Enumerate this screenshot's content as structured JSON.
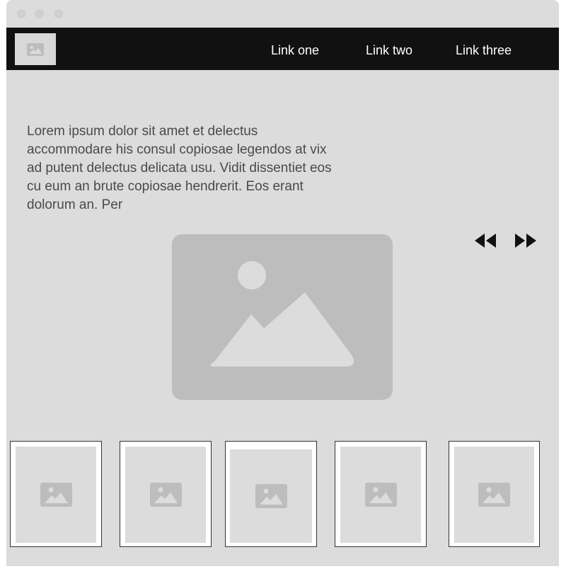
{
  "nav": {
    "logo_icon": "image-placeholder-icon",
    "links": [
      "Link one",
      "Link two",
      "Link three"
    ]
  },
  "content": {
    "text": "Lorem ipsum dolor sit amet et delectus accommodare his consul copiosae legendos at vix ad putent delectus delicata usu. Vidit dissentiet eos cu eum an brute copiosae hendrerit. Eos erant dolorum an. Per",
    "hero_icon": "image-placeholder-icon"
  },
  "carousel": {
    "prev_icon": "rewind-icon",
    "next_icon": "fast-forward-icon"
  },
  "thumbnails": [
    {
      "icon": "image-placeholder-icon"
    },
    {
      "icon": "image-placeholder-icon"
    },
    {
      "icon": "image-placeholder-icon"
    },
    {
      "icon": "image-placeholder-icon"
    },
    {
      "icon": "image-placeholder-icon"
    }
  ],
  "colors": {
    "background": "#dcdcdc",
    "navbar": "#111111",
    "placeholder": "#bdbdbd",
    "text": "#4a4a4a"
  }
}
